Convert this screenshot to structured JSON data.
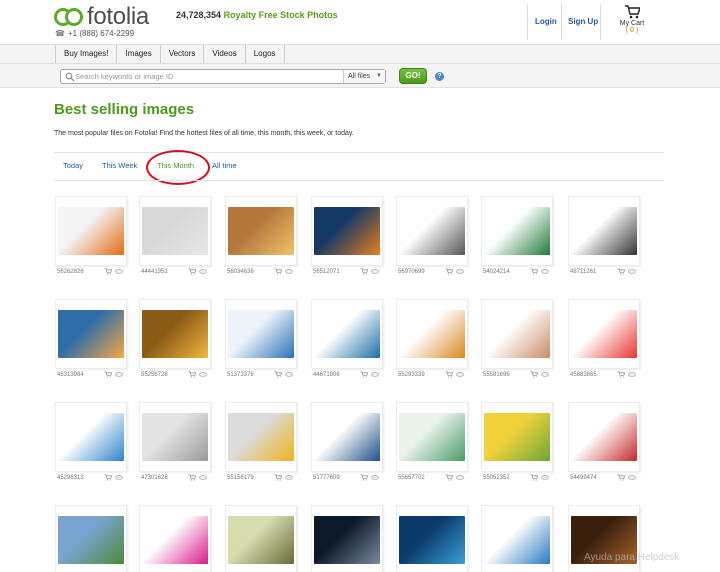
{
  "header": {
    "logo_text": "fotolia",
    "phone": "+1 (888) 674-2299",
    "tagline_count": "24,728,354",
    "tagline_text": "Royalty Free Stock Photos",
    "login_label": "Login",
    "signup_label": "Sign Up",
    "cart_label": "My Cart",
    "cart_count": "( 0 )"
  },
  "nav": {
    "tabs": [
      "Buy Images!",
      "Images",
      "Vectors",
      "Videos",
      "Logos"
    ]
  },
  "search": {
    "placeholder": "Search keywords or image ID",
    "filter_value": "All files",
    "go_label": "GO!",
    "help_symbol": "?"
  },
  "main": {
    "title": "Best selling images",
    "description": "The most popular files on Fotolia! Find the hottest files of all time, this month, this week, or today.",
    "tabs": [
      {
        "label": "Today",
        "active": false
      },
      {
        "label": "This Week",
        "active": false
      },
      {
        "label": "This Month",
        "active": true
      },
      {
        "label": "All time",
        "active": false
      }
    ]
  },
  "colors": {
    "brand_green": "#4e9a1e",
    "link_blue": "#1f5c9a",
    "highlight_red": "#d6101b",
    "cart_orange": "#e07b00"
  },
  "grid": {
    "rows": [
      [
        {
          "id": "56262826",
          "thumb": "halloween-pumpkins",
          "colors": [
            "#f4f4f4",
            "#e46a12"
          ]
        },
        {
          "id": "44441951",
          "thumb": "impossible-pencil",
          "colors": [
            "#d8d8d8",
            "#e6e6e6"
          ]
        },
        {
          "id": "56034638",
          "thumb": "autumn-park",
          "colors": [
            "#b3773b",
            "#f0c36a"
          ]
        },
        {
          "id": "56512071",
          "thumb": "spooky-pumpkin",
          "colors": [
            "#163a66",
            "#e8801e"
          ]
        },
        {
          "id": "56970699",
          "thumb": "icon-set-800",
          "colors": [
            "#ffffff",
            "#555555"
          ]
        },
        {
          "id": "54024214",
          "thumb": "change-street-sign",
          "colors": [
            "#ffffff",
            "#1f7a3a"
          ]
        },
        {
          "id": "48711261",
          "thumb": "universal-icons",
          "colors": [
            "#ffffff",
            "#333333"
          ]
        }
      ],
      [
        {
          "id": "45313984",
          "thumb": "sunset-pier",
          "colors": [
            "#2f6ea8",
            "#f5a744"
          ]
        },
        {
          "id": "55256728",
          "thumb": "autumn-leaves",
          "colors": [
            "#8a5a16",
            "#f2b640"
          ]
        },
        {
          "id": "51373376",
          "thumb": "network-hand",
          "colors": [
            "#eef4fa",
            "#2a72b6"
          ]
        },
        {
          "id": "44671806",
          "thumb": "web-icons-blue",
          "colors": [
            "#ffffff",
            "#1c6ea4"
          ]
        },
        {
          "id": "55293339",
          "thumb": "falling-leaves",
          "colors": [
            "#ffffff",
            "#d8881d"
          ]
        },
        {
          "id": "55581696",
          "thumb": "raised-hands",
          "colors": [
            "#ffffff",
            "#c98c6a"
          ]
        },
        {
          "id": "45883865",
          "thumb": "balloons",
          "colors": [
            "#ffffff",
            "#e8342c"
          ]
        }
      ],
      [
        {
          "id": "45296313",
          "thumb": "tablet-apps",
          "colors": [
            "#ffffff",
            "#2e82c8"
          ]
        },
        {
          "id": "47301626",
          "thumb": "wall-sketch",
          "colors": [
            "#e4e4e4",
            "#9a9a9a"
          ]
        },
        {
          "id": "55156179",
          "thumb": "lightbulb-splash",
          "colors": [
            "#dcdcdc",
            "#f0b21c"
          ]
        },
        {
          "id": "51777609",
          "thumb": "devices",
          "colors": [
            "#ffffff",
            "#1f4f8a"
          ]
        },
        {
          "id": "55657702",
          "thumb": "workspace",
          "colors": [
            "#eaf2ea",
            "#4a9a6a"
          ]
        },
        {
          "id": "55052352",
          "thumb": "sunflowers",
          "colors": [
            "#f2d23a",
            "#6aa83a"
          ]
        },
        {
          "id": "54499474",
          "thumb": "compass",
          "colors": [
            "#ffffff",
            "#c22a2a"
          ]
        }
      ],
      [
        {
          "id": "",
          "thumb": "house",
          "colors": [
            "#7aa4d0",
            "#4e8a3a"
          ]
        },
        {
          "id": "",
          "thumb": "color-people",
          "colors": [
            "#ffffff",
            "#d81a8a"
          ]
        },
        {
          "id": "",
          "thumb": "tree-roots",
          "colors": [
            "#d6dcae",
            "#6a6a3a"
          ]
        },
        {
          "id": "",
          "thumb": "city-night",
          "colors": [
            "#0e1a2a",
            "#7a8aa0"
          ]
        },
        {
          "id": "",
          "thumb": "smartphone-touch",
          "colors": [
            "#0a3a6a",
            "#3aa0d8"
          ]
        },
        {
          "id": "",
          "thumb": "icon-grid",
          "colors": [
            "#ffffff",
            "#2a7ac0"
          ]
        },
        {
          "id": "",
          "thumb": "coffee-cup",
          "colors": [
            "#3a1e0e",
            "#a8642e"
          ]
        }
      ]
    ]
  },
  "watermark": "Ayuda para Helpdesk"
}
